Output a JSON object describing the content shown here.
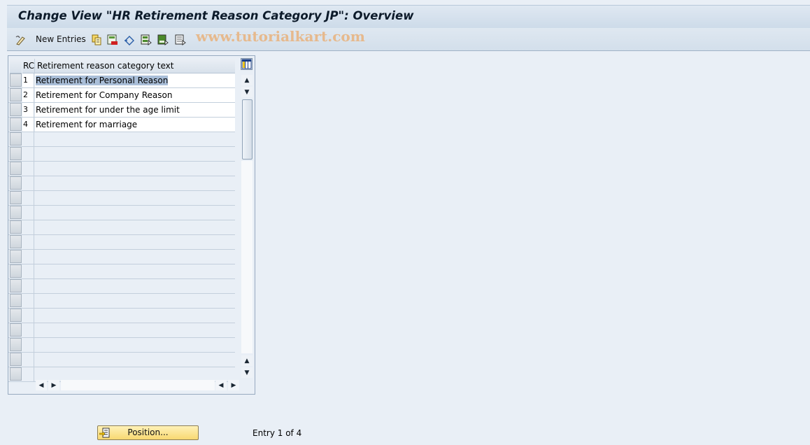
{
  "title": "Change View \"HR Retirement Reason Category JP\": Overview",
  "toolbar": {
    "new_entries_label": "New Entries",
    "icons": [
      "edit-toggle-icon",
      "copy-as-icon",
      "delete-icon",
      "undo-change-icon",
      "select-all-icon",
      "select-block-icon",
      "deselect-all-icon"
    ],
    "watermark": "www.tutorialkart.com"
  },
  "table": {
    "columns": [
      "RC",
      "Retirement reason category text"
    ],
    "rows": [
      {
        "rc": "1",
        "text": "Retirement for Personal Reason",
        "selected": true
      },
      {
        "rc": "2",
        "text": "Retirement for Company Reason",
        "selected": false
      },
      {
        "rc": "3",
        "text": "Retirement for under the age limit",
        "selected": false
      },
      {
        "rc": "4",
        "text": "Retirement for marriage",
        "selected": false
      }
    ],
    "empty_rows": 17
  },
  "footer": {
    "position_label": "Position...",
    "entry_text": "Entry 1 of 4"
  }
}
